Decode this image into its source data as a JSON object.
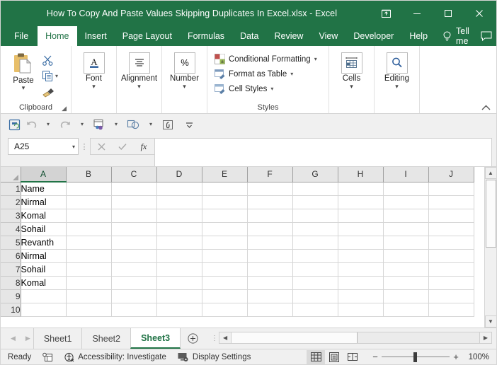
{
  "window": {
    "title": "How To Copy And Paste Values Skipping Duplicates In Excel.xlsx  -  Excel",
    "controls": {
      "ribbon_display": "ribbon-display-options",
      "minimize": "minimize",
      "maximize": "maximize",
      "close": "close"
    }
  },
  "colors": {
    "excel_green": "#217346",
    "ribbon_bg": "#ffffff",
    "chrome_bg": "#f0f0f0",
    "header_bg": "#e6e6e6",
    "gridline": "#d6d6d6",
    "selected_header": "#d3d3d3"
  },
  "ribbon": {
    "tabs": [
      {
        "label": "File",
        "active": false
      },
      {
        "label": "Home",
        "active": true
      },
      {
        "label": "Insert",
        "active": false
      },
      {
        "label": "Page Layout",
        "active": false
      },
      {
        "label": "Formulas",
        "active": false
      },
      {
        "label": "Data",
        "active": false
      },
      {
        "label": "Review",
        "active": false
      },
      {
        "label": "View",
        "active": false
      },
      {
        "label": "Developer",
        "active": false
      },
      {
        "label": "Help",
        "active": false
      }
    ],
    "tell_me": "Tell me",
    "tell_me_icon": "lightbulb-icon",
    "comments_icon": "comment-icon",
    "collapse_icon": "chevron-up-icon",
    "groups": {
      "clipboard": {
        "label": "Clipboard",
        "paste_label": "Paste",
        "paste_icon": "clipboard-icon",
        "cut_icon": "scissors-icon",
        "copy_icon": "copy-icon",
        "format_painter_icon": "paintbrush-icon",
        "launcher_icon": "dialog-launcher-icon"
      },
      "font": {
        "label": "Font",
        "icon": "font-letter-a-icon"
      },
      "alignment": {
        "label": "Alignment",
        "icon": "align-lines-icon"
      },
      "number": {
        "label": "Number",
        "icon": "percent-icon"
      },
      "styles": {
        "label": "Styles",
        "items": [
          {
            "label": "Conditional Formatting",
            "icon": "conditional-formatting-icon"
          },
          {
            "label": "Format as Table",
            "icon": "format-as-table-icon"
          },
          {
            "label": "Cell Styles",
            "icon": "cell-styles-icon"
          }
        ]
      },
      "cells": {
        "label": "Cells",
        "icon": "cells-table-icon"
      },
      "editing": {
        "label": "Editing",
        "icon": "magnifier-icon"
      }
    }
  },
  "quick_access": {
    "items": [
      {
        "name": "save-icon",
        "enabled": true
      },
      {
        "name": "undo-icon",
        "enabled": false
      },
      {
        "name": "redo-icon",
        "enabled": false
      },
      {
        "name": "share-people-icon",
        "enabled": true
      },
      {
        "name": "touch-shape-icon",
        "enabled": true
      },
      {
        "name": "attach-icon",
        "enabled": true
      },
      {
        "name": "customize-quick-access-toolbar-icon",
        "enabled": true
      }
    ]
  },
  "formula_bar": {
    "name_box_value": "A25",
    "name_box_caret": "chevron-down-icon",
    "cancel_icon": "cancel-x-icon",
    "enter_icon": "confirm-check-icon",
    "function_icon": "fx",
    "input_value": "",
    "expand_icon": "chevron-up-icon"
  },
  "grid": {
    "columns": [
      "A",
      "B",
      "C",
      "D",
      "E",
      "F",
      "G",
      "H",
      "I",
      "J"
    ],
    "selected_column": "A",
    "rows": [
      {
        "num": "1",
        "cells": [
          "Name",
          "",
          "",
          "",
          "",
          "",
          "",
          "",
          "",
          ""
        ]
      },
      {
        "num": "2",
        "cells": [
          "Nirmal",
          "",
          "",
          "",
          "",
          "",
          "",
          "",
          "",
          ""
        ]
      },
      {
        "num": "3",
        "cells": [
          "Komal",
          "",
          "",
          "",
          "",
          "",
          "",
          "",
          "",
          ""
        ]
      },
      {
        "num": "4",
        "cells": [
          "Sohail",
          "",
          "",
          "",
          "",
          "",
          "",
          "",
          "",
          ""
        ]
      },
      {
        "num": "5",
        "cells": [
          "Revanth",
          "",
          "",
          "",
          "",
          "",
          "",
          "",
          "",
          ""
        ]
      },
      {
        "num": "6",
        "cells": [
          "Nirmal",
          "",
          "",
          "",
          "",
          "",
          "",
          "",
          "",
          ""
        ]
      },
      {
        "num": "7",
        "cells": [
          "Sohail",
          "",
          "",
          "",
          "",
          "",
          "",
          "",
          "",
          ""
        ]
      },
      {
        "num": "8",
        "cells": [
          "Komal",
          "",
          "",
          "",
          "",
          "",
          "",
          "",
          "",
          ""
        ]
      },
      {
        "num": "9",
        "cells": [
          "",
          "",
          "",
          "",
          "",
          "",
          "",
          "",
          "",
          ""
        ]
      },
      {
        "num": "10",
        "cells": [
          "",
          "",
          "",
          "",
          "",
          "",
          "",
          "",
          "",
          ""
        ]
      }
    ]
  },
  "sheet_tabs": {
    "prev_icon": "nav-first-icon",
    "next_icon": "nav-last-icon",
    "tabs": [
      {
        "label": "Sheet1",
        "active": false
      },
      {
        "label": "Sheet2",
        "active": false
      },
      {
        "label": "Sheet3",
        "active": true
      }
    ],
    "new_sheet_icon": "plus-circle-icon"
  },
  "status_bar": {
    "mode": "Ready",
    "macro_icon": "record-macro-icon",
    "accessibility_icon": "accessibility-icon",
    "accessibility": "Accessibility: Investigate",
    "display_settings_icon": "display-settings-icon",
    "display_settings": "Display Settings",
    "views": [
      {
        "name": "normal-view-button",
        "active": true
      },
      {
        "name": "page-layout-view-button",
        "active": false
      },
      {
        "name": "page-break-preview-button",
        "active": false
      }
    ],
    "zoom_out": "−",
    "zoom_in": "+",
    "zoom_level": "100%"
  }
}
